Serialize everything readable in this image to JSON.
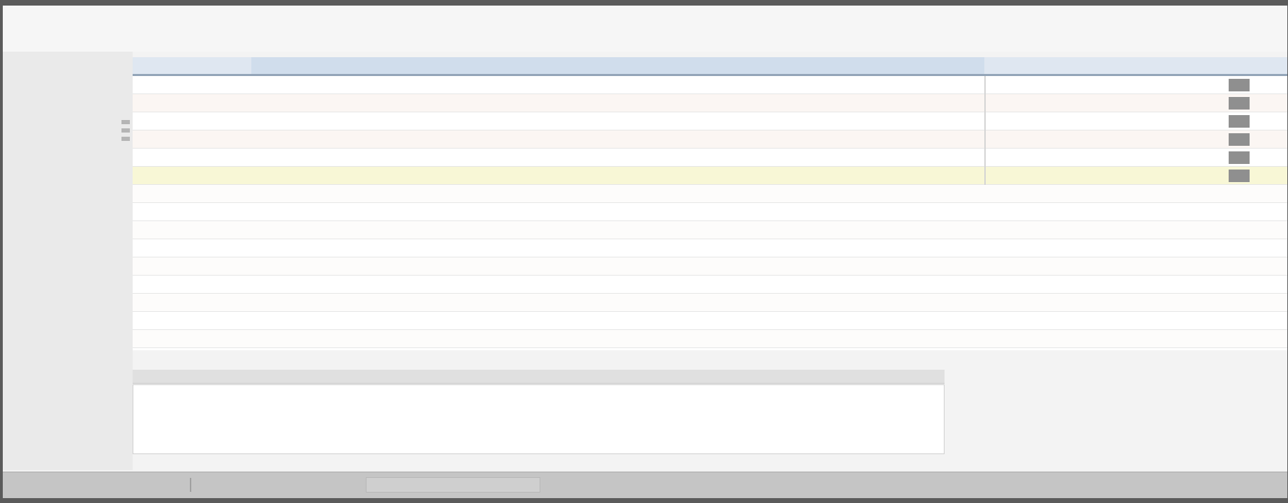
{
  "top_fields": [
    {
      "label": "",
      "value": ""
    },
    {
      "label": "",
      "value": ""
    }
  ],
  "grid": {
    "columns": [
      "",
      "",
      "",
      ""
    ],
    "rows": [
      {
        "c1": "",
        "c2": "",
        "c3": "",
        "c4": ""
      },
      {
        "c1": "",
        "c2": "",
        "c3": "",
        "c4": ""
      },
      {
        "c1": "",
        "c2": "",
        "c3": "",
        "c4": ""
      },
      {
        "c1": "",
        "c2": "",
        "c3": "",
        "c4": ""
      },
      {
        "c1": "",
        "c2": "",
        "c3": "",
        "c4": ""
      },
      {
        "c1": "",
        "c2": "",
        "c3": "",
        "c4": ""
      }
    ],
    "selected_row_index": 5
  },
  "notes": {
    "label": "",
    "value": ""
  },
  "summary": [
    {
      "label": "",
      "value": ""
    },
    {
      "label": "",
      "value": ""
    },
    {
      "label": "",
      "value": ""
    },
    {
      "label": "",
      "value": ""
    },
    {
      "label": "",
      "value": ""
    }
  ],
  "statusbar": {
    "items": [
      "",
      "",
      "",
      "",
      ""
    ]
  },
  "colors": {
    "header_bg": "#dfe7f1",
    "selected_row": "#f8f7d6",
    "status_bg": "#c5c5c5"
  }
}
